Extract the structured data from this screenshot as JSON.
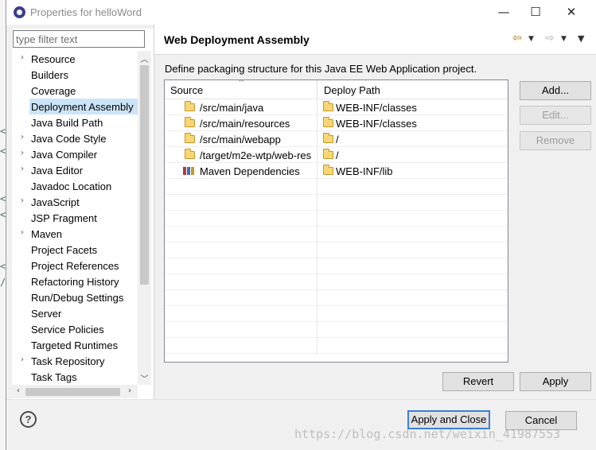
{
  "window": {
    "title": "Properties for helloWord",
    "minimize": "—",
    "maximize": "☐",
    "close": "✕"
  },
  "filter": {
    "placeholder": "type filter text"
  },
  "tree": {
    "items": [
      {
        "label": "Resource",
        "expandable": true,
        "selected": false
      },
      {
        "label": "Builders",
        "expandable": false,
        "selected": false
      },
      {
        "label": "Coverage",
        "expandable": false,
        "selected": false
      },
      {
        "label": "Deployment Assembly",
        "expandable": false,
        "selected": true
      },
      {
        "label": "Java Build Path",
        "expandable": false,
        "selected": false
      },
      {
        "label": "Java Code Style",
        "expandable": true,
        "selected": false
      },
      {
        "label": "Java Compiler",
        "expandable": true,
        "selected": false
      },
      {
        "label": "Java Editor",
        "expandable": true,
        "selected": false
      },
      {
        "label": "Javadoc Location",
        "expandable": false,
        "selected": false
      },
      {
        "label": "JavaScript",
        "expandable": true,
        "selected": false
      },
      {
        "label": "JSP Fragment",
        "expandable": false,
        "selected": false
      },
      {
        "label": "Maven",
        "expandable": true,
        "selected": false
      },
      {
        "label": "Project Facets",
        "expandable": false,
        "selected": false
      },
      {
        "label": "Project References",
        "expandable": false,
        "selected": false
      },
      {
        "label": "Refactoring History",
        "expandable": false,
        "selected": false
      },
      {
        "label": "Run/Debug Settings",
        "expandable": false,
        "selected": false
      },
      {
        "label": "Server",
        "expandable": false,
        "selected": false
      },
      {
        "label": "Service Policies",
        "expandable": false,
        "selected": false
      },
      {
        "label": "Targeted Runtimes",
        "expandable": false,
        "selected": false
      },
      {
        "label": "Task Repository",
        "expandable": true,
        "selected": false
      },
      {
        "label": "Task Tags",
        "expandable": false,
        "selected": false
      }
    ]
  },
  "page": {
    "title": "Web Deployment Assembly",
    "description": "Define packaging structure for this Java EE Web Application project.",
    "nav_icons": [
      "back-arrow-icon",
      "forward-arrow-icon",
      "view-menu-icon"
    ]
  },
  "table": {
    "columns": [
      "Source",
      "Deploy Path"
    ],
    "rows": [
      {
        "source": "/src/main/java",
        "source_icon": "folder-icon",
        "deploy": "WEB-INF/classes"
      },
      {
        "source": "/src/main/resources",
        "source_icon": "folder-icon",
        "deploy": "WEB-INF/classes"
      },
      {
        "source": "/src/main/webapp",
        "source_icon": "folder-icon",
        "deploy": "/"
      },
      {
        "source": "/target/m2e-wtp/web-res",
        "source_icon": "folder-icon",
        "deploy": "/"
      },
      {
        "source": "Maven Dependencies",
        "source_icon": "maven-library-icon",
        "deploy": "WEB-INF/lib"
      }
    ]
  },
  "side_buttons": {
    "add": "Add...",
    "edit": "Edit...",
    "remove": "Remove"
  },
  "page_buttons": {
    "revert": "Revert",
    "apply": "Apply"
  },
  "footer": {
    "help": "?",
    "apply_close": "Apply and Close",
    "cancel": "Cancel"
  },
  "watermark": "https://blog.csdn.net/weixin_41987553",
  "colors": {
    "selection": "#cce4f7",
    "primary_border": "#3c7fd6",
    "folder": "#f7d774"
  }
}
